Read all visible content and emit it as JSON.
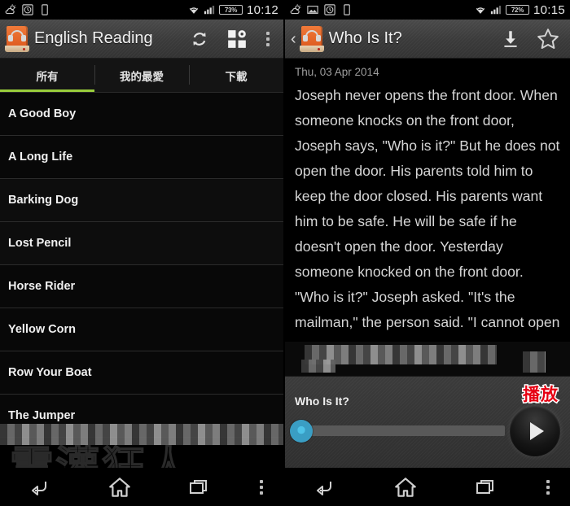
{
  "left": {
    "statusbar": {
      "icons": [
        "weather-icon",
        "alarm-icon",
        "device-icon"
      ],
      "wifi": "wifi-icon",
      "signal": "signal-icon",
      "battery": "73%",
      "time": "10:12"
    },
    "actionbar": {
      "title": "English Reading",
      "refresh": "refresh-icon",
      "grid": "grid-icon",
      "overflow": "overflow-icon"
    },
    "tabs": [
      {
        "label": "所有",
        "active": true
      },
      {
        "label": "我的最愛",
        "active": false
      },
      {
        "label": "下載",
        "active": false
      }
    ],
    "list": [
      "A Good Boy",
      "A Long Life",
      "Barking Dog",
      "Lost Pencil",
      "Horse Rider",
      "Yellow Corn",
      "Row Your Boat",
      "The Jumper"
    ],
    "watermark": {
      "cn": "電灌狂人",
      "url": "HTTP://BRIIAN.COM"
    },
    "navbar": [
      "back-icon",
      "home-icon",
      "recents-icon",
      "menu-icon"
    ]
  },
  "right": {
    "statusbar": {
      "icons": [
        "weather-icon",
        "image-icon",
        "alarm-icon",
        "device-icon"
      ],
      "wifi": "wifi-icon",
      "signal": "signal-icon",
      "battery": "72%",
      "time": "10:15"
    },
    "actionbar": {
      "back": "back-caret-icon",
      "title": "Who Is It?",
      "download": "download-icon",
      "favorite": "star-icon"
    },
    "date": "Thu, 03 Apr 2014",
    "body": "Joseph never opens the front door. When someone knocks on the front door, Joseph says, \"Who is it?\" But he does not open the door. His parents told him to keep the door closed. His parents want him to be safe. He will be safe if he doesn't open the door. Yesterday someone knocked on the front door. \"Who is it?\" Joseph asked. \"It's the mailman,\" the person said. \"I cannot open the door,\" Joseph said. \"Okay, I will come back tomorrow,\" the mailman said. \"Goodbye,\" Joseph said. Joseph is a",
    "player": {
      "title": "Who Is It?",
      "play_label": "播放",
      "play_icon": "play-icon",
      "seek_value": 0,
      "thumb_color": "#3a9ec4"
    },
    "navbar": [
      "back-icon",
      "home-icon",
      "recents-icon",
      "menu-icon"
    ]
  },
  "colors": {
    "accent_green": "#9ace3c",
    "brand_orange": "#dd5a1e",
    "play_red": "#e60012"
  }
}
